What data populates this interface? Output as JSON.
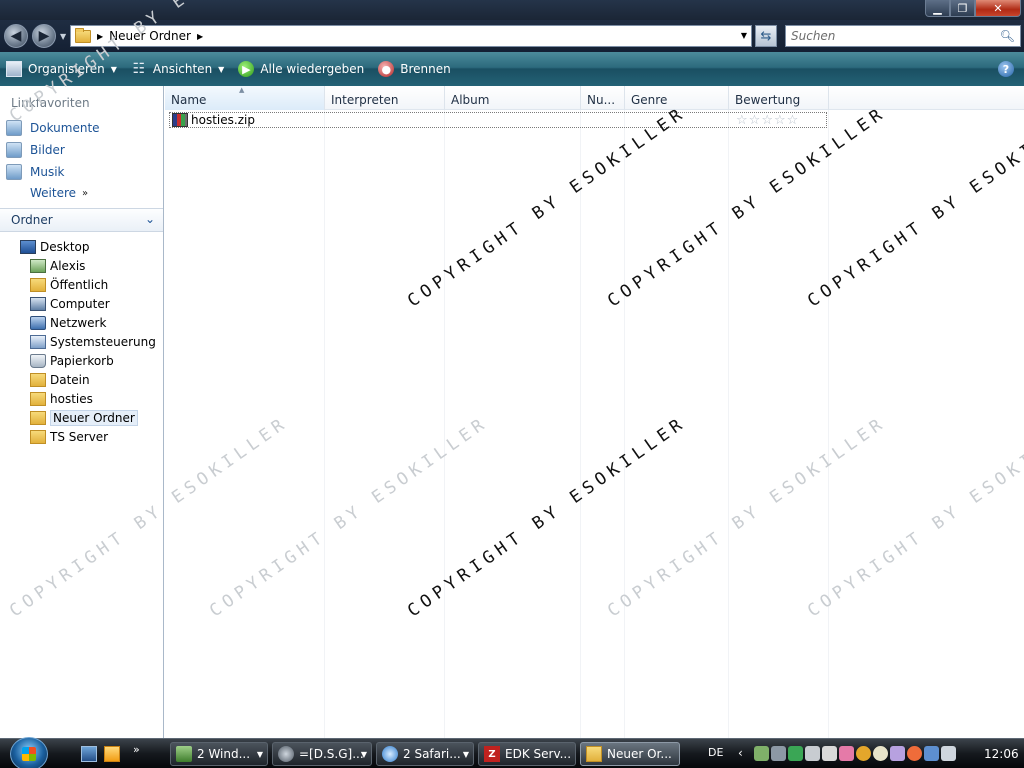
{
  "window": {
    "minimize_icon": "minimize-icon",
    "maximize_icon": "maximize-icon",
    "close_icon": "close-icon"
  },
  "address": {
    "path": [
      "Neuer Ordner"
    ],
    "search_placeholder": "Suchen"
  },
  "toolbar": {
    "organize": "Organisieren",
    "views": "Ansichten",
    "play_all": "Alle wiedergeben",
    "burn": "Brennen",
    "help": "?"
  },
  "sidebar": {
    "favorites_header": "Linkfavoriten",
    "favorites": [
      {
        "label": "Dokumente"
      },
      {
        "label": "Bilder"
      },
      {
        "label": "Musik"
      }
    ],
    "more_label": "Weitere",
    "more_chevron": "»",
    "folders_header": "Ordner",
    "tree": [
      {
        "label": "Desktop",
        "icon": "desktop-icon"
      },
      {
        "label": "Alexis",
        "icon": "user-folder-icon"
      },
      {
        "label": "Öffentlich",
        "icon": "folder-icon"
      },
      {
        "label": "Computer",
        "icon": "computer-icon"
      },
      {
        "label": "Netzwerk",
        "icon": "network-icon"
      },
      {
        "label": "Systemsteuerung",
        "icon": "control-panel-icon"
      },
      {
        "label": "Papierkorb",
        "icon": "recycle-bin-icon"
      },
      {
        "label": "Datein",
        "icon": "folder-icon"
      },
      {
        "label": "hosties",
        "icon": "folder-icon"
      },
      {
        "label": "Neuer Ordner",
        "icon": "folder-icon",
        "selected": true
      },
      {
        "label": "TS Server",
        "icon": "folder-icon"
      }
    ]
  },
  "columns": [
    "Name",
    "Interpreten",
    "Album",
    "Nu...",
    "Genre",
    "Bewertung"
  ],
  "files": [
    {
      "name": "hosties.zip",
      "icon": "zip-archive-icon",
      "rating": 0,
      "rating_max": 5
    }
  ],
  "watermark": "COPYRIGHT BY ESOKILLER",
  "taskbar": {
    "buttons": [
      {
        "label": "2 Wind...",
        "icon": "windows-explorer-icon",
        "has_menu": true
      },
      {
        "label": "=[D.S.G]...",
        "icon": "steam-icon",
        "has_menu": true
      },
      {
        "label": "2 Safari...",
        "icon": "safari-icon",
        "has_menu": true
      },
      {
        "label": "EDK Serv...",
        "icon": "filezilla-icon",
        "has_menu": false
      },
      {
        "label": "Neuer Or...",
        "icon": "folder-icon",
        "has_menu": false,
        "active": true
      }
    ],
    "language": "DE",
    "clock": "12:06"
  },
  "colors": {
    "accent_link": "#1c5396",
    "toolbar_bg": "#2c6a7d",
    "title_bg": "#1b2636"
  }
}
